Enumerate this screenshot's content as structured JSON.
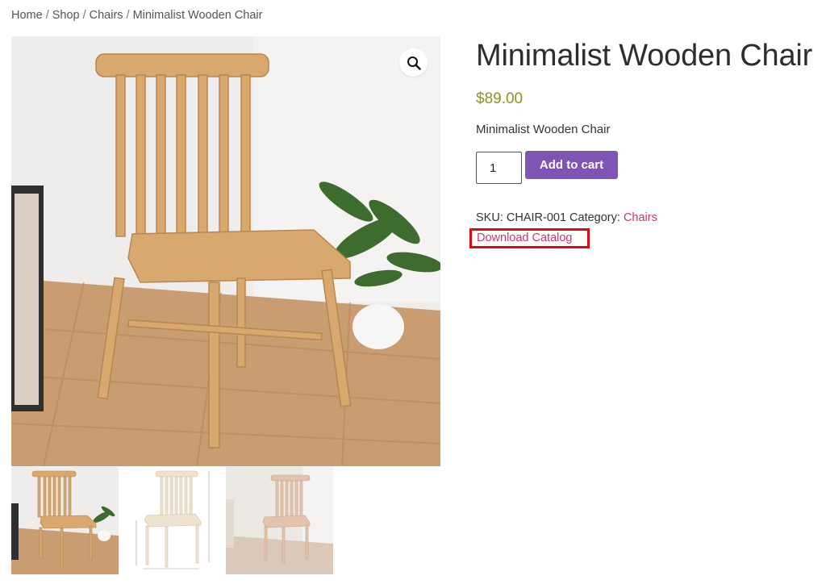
{
  "breadcrumb": {
    "home": "Home",
    "shop": "Shop",
    "category": "Chairs",
    "current": "Minimalist Wooden Chair",
    "separator": "/"
  },
  "product": {
    "title": "Minimalist Wooden Chair",
    "price": "$89.00",
    "short_description": "Minimalist Wooden Chair",
    "quantity": "1",
    "add_to_cart_label": "Add to cart",
    "sku_label": "SKU:",
    "sku": "CHAIR-001",
    "category_label": "Category:",
    "category": "Chairs",
    "download_label": "Download Catalog"
  },
  "gallery": {
    "zoom_icon": "magnifier-icon",
    "thumbnail_count": 3
  },
  "colors": {
    "price": "#7f9a1f",
    "button": "#7f54b3",
    "link": "#d6336c",
    "highlight_box": "#e30613"
  }
}
